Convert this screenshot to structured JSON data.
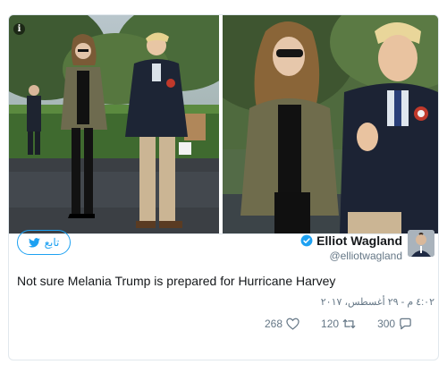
{
  "tweet": {
    "follow_label": "تابع",
    "display_name": "Elliot Wagland",
    "handle": "@elliotwagland",
    "text": "Not sure Melania Trump is prepared for Hurricane Harvey",
    "timestamp": "٤:٠٢ م - ٢٩ أغسطس، ٢٠١٧",
    "likes": "268",
    "retweets": "120",
    "replies": "300"
  },
  "media": {
    "info_label": "i"
  },
  "colors": {
    "accent": "#1da1f2",
    "muted": "#657786",
    "text": "#14171a",
    "border": "#e1e8ed"
  },
  "icons": {
    "info": "info-icon",
    "bird": "twitter-bird-icon",
    "verified": "verified-badge-icon",
    "like": "heart-icon",
    "retweet": "retweet-icon",
    "reply": "reply-bubble-icon"
  }
}
